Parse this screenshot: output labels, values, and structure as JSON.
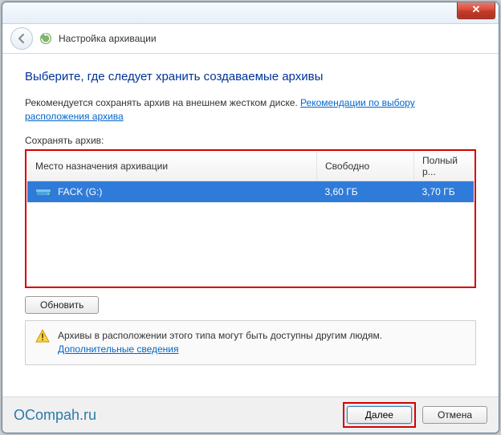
{
  "titlebar": {
    "close_glyph": "✕"
  },
  "header": {
    "title": "Настройка архивации"
  },
  "main": {
    "heading": "Выберите, где следует хранить создаваемые архивы",
    "desc_text": "Рекомендуется сохранять архив на внешнем жестком диске. ",
    "desc_link": "Рекомендации по выбору расположения архива",
    "save_label": "Сохранять архив:"
  },
  "table": {
    "columns": {
      "destination": "Место назначения архивации",
      "free": "Свободно",
      "total": "Полный р..."
    },
    "rows": [
      {
        "name": "FACK (G:)",
        "free": "3,60 ГБ",
        "total": "3,70 ГБ"
      }
    ]
  },
  "buttons": {
    "refresh": "Обновить",
    "next": "Далее",
    "cancel": "Отмена"
  },
  "warning": {
    "text": "Архивы в расположении этого типа могут быть доступны другим людям.",
    "link": "Дополнительные сведения"
  },
  "watermark": "OCompah.ru"
}
